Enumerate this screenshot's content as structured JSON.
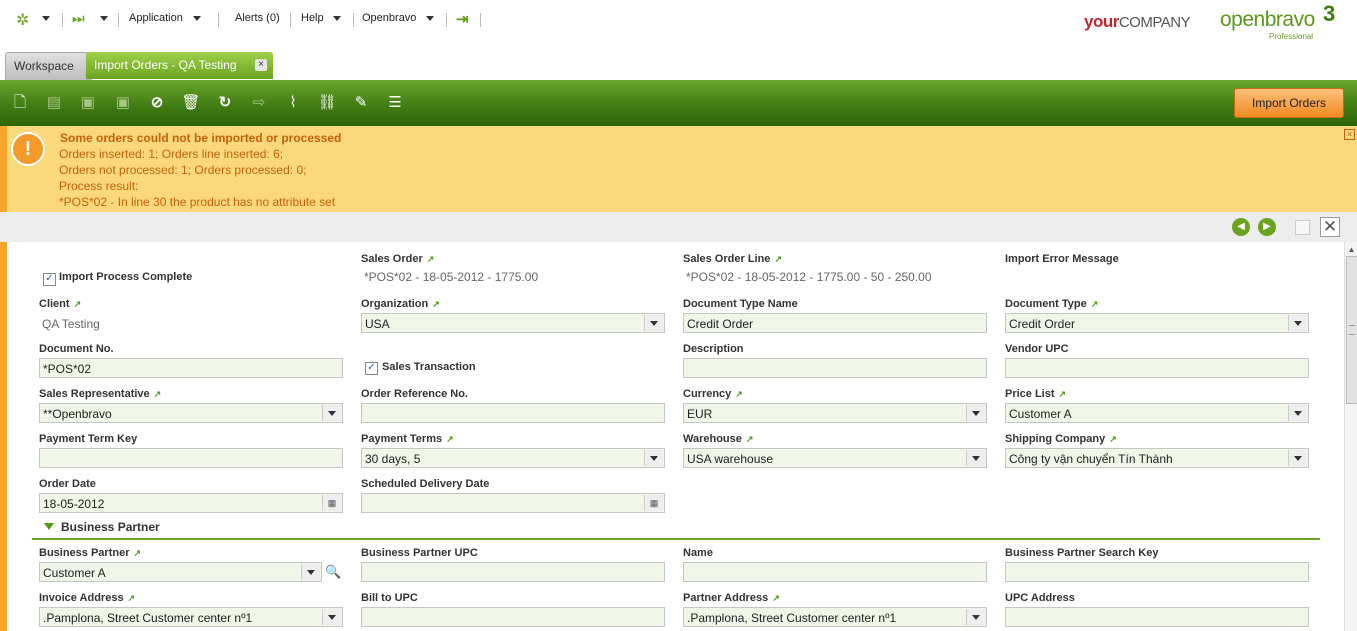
{
  "topbar": {
    "app_menu": "Application",
    "alerts": "Alerts (0)",
    "help": "Help",
    "user_menu": "Openbravo"
  },
  "logos": {
    "your": "your",
    "company": "COMPANY",
    "openbravo": "openbravo",
    "version": "3",
    "edition": "Professional"
  },
  "tabs": {
    "workspace": "Workspace",
    "active": "Import Orders - QA Testing",
    "close_glyph": "×"
  },
  "toolbar": {
    "import_button": "Import Orders"
  },
  "message": {
    "title": "Some orders could not be imported or processed",
    "line1": "Orders inserted: 1; Orders line inserted: 6;",
    "line2": "Orders not processed: 1; Orders processed: 0;",
    "line3": "Process result:",
    "line4": "*POS*02 - In line 30 the product has no attribute set",
    "icon_glyph": "!",
    "close_glyph": "×"
  },
  "form": {
    "import_process_complete": {
      "label": "Import Process Complete",
      "checked": true
    },
    "sales_order": {
      "label": "Sales Order",
      "value": "*POS*02 - 18-05-2012 - 1775.00"
    },
    "sales_order_line": {
      "label": "Sales Order Line",
      "value": "*POS*02 - 18-05-2012 - 1775.00 - 50 - 250.00"
    },
    "import_error_message": {
      "label": "Import Error Message"
    },
    "client": {
      "label": "Client",
      "value": "QA Testing"
    },
    "organization": {
      "label": "Organization",
      "value": "USA"
    },
    "document_type_name": {
      "label": "Document Type Name",
      "value": "Credit Order"
    },
    "document_type": {
      "label": "Document Type",
      "value": "Credit Order"
    },
    "document_no": {
      "label": "Document No.",
      "value": "*POS*02"
    },
    "sales_transaction": {
      "label": "Sales Transaction",
      "checked": true
    },
    "description": {
      "label": "Description",
      "value": ""
    },
    "vendor_upc": {
      "label": "Vendor UPC",
      "value": ""
    },
    "sales_representative": {
      "label": "Sales Representative",
      "value": "**Openbravo"
    },
    "order_reference_no": {
      "label": "Order Reference No.",
      "value": ""
    },
    "currency": {
      "label": "Currency",
      "value": "EUR"
    },
    "price_list": {
      "label": "Price List",
      "value": "Customer A"
    },
    "payment_term_key": {
      "label": "Payment Term Key",
      "value": ""
    },
    "payment_terms": {
      "label": "Payment Terms",
      "value": "30 days, 5"
    },
    "warehouse": {
      "label": "Warehouse",
      "value": "USA warehouse"
    },
    "shipping_company": {
      "label": "Shipping Company",
      "value": "Công ty vận chuyển Tín Thành"
    },
    "order_date": {
      "label": "Order Date",
      "value": "18-05-2012"
    },
    "scheduled_delivery_date": {
      "label": "Scheduled Delivery Date",
      "value": ""
    }
  },
  "business_partner_section": {
    "title": "Business Partner",
    "business_partner": {
      "label": "Business Partner",
      "value": "Customer A"
    },
    "business_partner_upc": {
      "label": "Business Partner UPC",
      "value": ""
    },
    "name": {
      "label": "Name",
      "value": ""
    },
    "bp_search_key": {
      "label": "Business Partner Search Key",
      "value": ""
    },
    "invoice_address": {
      "label": "Invoice Address",
      "value": ".Pamplona, Street Customer center nº1"
    },
    "bill_to_upc": {
      "label": "Bill to UPC",
      "value": ""
    },
    "partner_address": {
      "label": "Partner Address",
      "value": ".Pamplona, Street Customer center nº1"
    },
    "upc_address": {
      "label": "UPC Address",
      "value": ""
    }
  },
  "colors": {
    "brand_green": "#6aa320",
    "toolbar_dark": "#3f7a12",
    "warning_bg": "#fcd87c",
    "warning_text": "#c6610a",
    "accent_orange": "#f6a52a"
  }
}
